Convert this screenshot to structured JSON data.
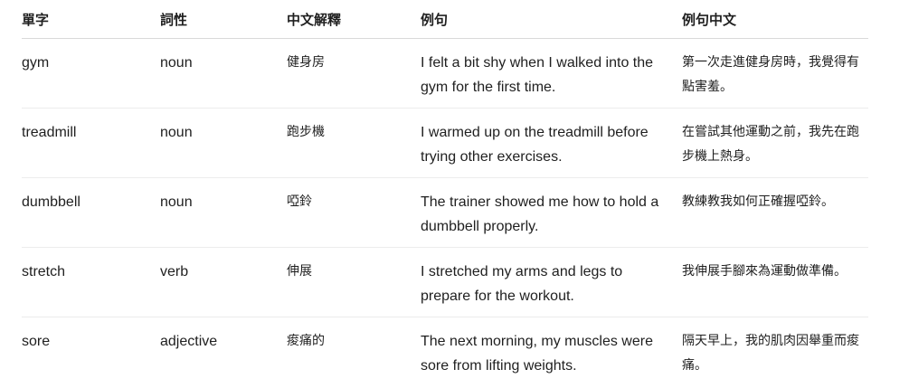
{
  "headers": [
    "單字",
    "詞性",
    "中文解釋",
    "例句",
    "例句中文"
  ],
  "rows": [
    {
      "word": "gym",
      "pos": "noun",
      "meaning": "健身房",
      "sentence": "I felt a bit shy when I walked into the gym for the first time.",
      "translation": "第一次走進健身房時，我覺得有點害羞。"
    },
    {
      "word": "treadmill",
      "pos": "noun",
      "meaning": "跑步機",
      "sentence": "I warmed up on the treadmill before trying other exercises.",
      "translation": "在嘗試其他運動之前，我先在跑步機上熱身。"
    },
    {
      "word": "dumbbell",
      "pos": "noun",
      "meaning": "啞鈴",
      "sentence": "The trainer showed me how to hold a dumbbell properly.",
      "translation": "教練教我如何正確握啞鈴。"
    },
    {
      "word": "stretch",
      "pos": "verb",
      "meaning": "伸展",
      "sentence": "I stretched my arms and legs to prepare for the workout.",
      "translation": "我伸展手腳來為運動做準備。"
    },
    {
      "word": "sore",
      "pos": "adjective",
      "meaning": "痠痛的",
      "sentence": "The next morning, my muscles were sore from lifting weights.",
      "translation": "隔天早上，我的肌肉因舉重而痠痛。"
    }
  ]
}
